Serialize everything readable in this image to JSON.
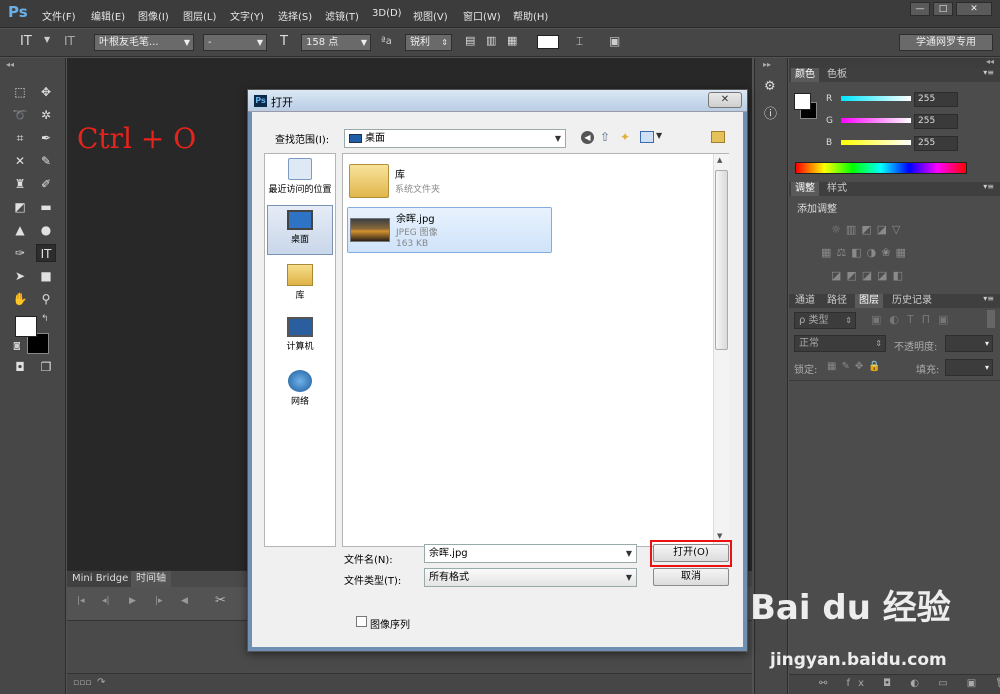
{
  "app": {
    "logo": "Ps"
  },
  "menu": [
    "文件(F)",
    "编辑(E)",
    "图像(I)",
    "图层(L)",
    "文字(Y)",
    "选择(S)",
    "滤镜(T)",
    "3D(D)",
    "视图(V)",
    "窗口(W)",
    "帮助(H)"
  ],
  "window_buttons": {
    "minimize": "—",
    "restore": "□",
    "close": "✕"
  },
  "options_bar": {
    "tool_glyph": "IT",
    "orient_glyph": "IT",
    "font_family": "叶根友毛笔...",
    "font_style": "-",
    "size_glyph": "T",
    "font_size": "158 点",
    "aa_glyph": "ªa",
    "anti_alias": "锐利",
    "workspace": "学通网罗专用"
  },
  "overlay_text": "Ctrl + O",
  "bottom_panel": {
    "tabs": [
      "Mini Bridge",
      "时间轴"
    ]
  },
  "right_panel": {
    "color_tabs": [
      "颜色",
      "色板"
    ],
    "channels": [
      {
        "label": "R",
        "value": "255",
        "color": "#00e5ff"
      },
      {
        "label": "G",
        "value": "255",
        "color": "#ff00ff"
      },
      {
        "label": "B",
        "value": "255",
        "color": "#ffff00"
      }
    ],
    "adjust_tabs": [
      "调整",
      "样式"
    ],
    "adjust_title": "添加调整",
    "layer_tabs": [
      "通道",
      "路径",
      "图层",
      "历史记录"
    ],
    "layer_filter": "ρ 类型",
    "blend_mode": "正常",
    "opacity_label": "不透明度:",
    "lock_label": "锁定:",
    "fill_label": "填充:"
  },
  "dialog": {
    "ps_icon": "Ps",
    "title": "打开",
    "close": "✕",
    "lookin_label": "查找范围(I):",
    "lookin_value": "桌面",
    "places": [
      "最近访问的位置",
      "桌面",
      "库",
      "计算机",
      "网络"
    ],
    "files": [
      {
        "name": "库",
        "line2": "系统文件夹",
        "line3": ""
      },
      {
        "name": "余晖.jpg",
        "line2": "JPEG 图像",
        "line3": "163 KB"
      }
    ],
    "filename_label": "文件名(N):",
    "filename_value": "余晖.jpg",
    "filetype_label": "文件类型(T):",
    "filetype_value": "所有格式",
    "open_button": "打开(O)",
    "cancel_button": "取消",
    "image_sequence": "图像序列"
  },
  "watermark": {
    "brand": "Bai du 经验",
    "url": "jingyan.baidu.com"
  }
}
